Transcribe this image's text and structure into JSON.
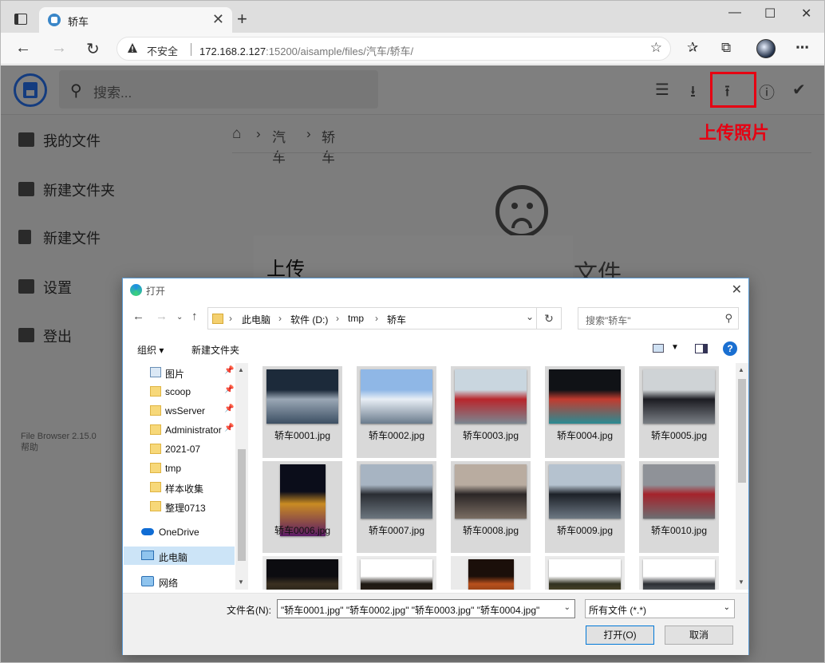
{
  "browser": {
    "tab_title": "轿车",
    "insecure_label": "不安全",
    "url_host": "172.168.2.127",
    "url_port": ":15200",
    "url_path": "/aisample/files/汽车/轿车/",
    "new_tab": "+",
    "close_tab": "✕"
  },
  "filebrowser": {
    "search_placeholder": "搜索...",
    "upload_callout": "上传照片",
    "sidebar": [
      {
        "label": "我的文件",
        "icon": "folder-icon"
      },
      {
        "label": "新建文件夹",
        "icon": "new-folder-icon"
      },
      {
        "label": "新建文件",
        "icon": "new-file-icon"
      },
      {
        "label": "设置",
        "icon": "settings-icon"
      },
      {
        "label": "登出",
        "icon": "logout-icon"
      }
    ],
    "version": "File Browser 2.15.0",
    "help": "帮助",
    "breadcrumbs": [
      "汽车",
      "轿车"
    ],
    "empty_text": "文件...",
    "modal_title": "上传"
  },
  "dialog": {
    "title": "打开",
    "path": [
      "此电脑",
      "软件 (D:)",
      "tmp",
      "轿车"
    ],
    "search_placeholder": "搜索\"轿车\"",
    "organize": "组织 ▾",
    "new_folder": "新建文件夹",
    "help": "?",
    "tree": [
      {
        "label": "图片",
        "pinned": true
      },
      {
        "label": "scoop",
        "pinned": true
      },
      {
        "label": "wsServer",
        "pinned": true
      },
      {
        "label": "Administrator",
        "pinned": true
      },
      {
        "label": "2021-07",
        "pinned": false
      },
      {
        "label": "tmp",
        "pinned": false
      },
      {
        "label": "样本收集",
        "pinned": false
      },
      {
        "label": "整理0713",
        "pinned": false
      }
    ],
    "onedrive": "OneDrive",
    "this_pc": "此电脑",
    "network": "网络",
    "files": [
      {
        "name": "轿车0001.jpg",
        "colors": [
          "#1c2a3a",
          "#9aa7b5",
          "#3c4f63"
        ]
      },
      {
        "name": "轿车0002.jpg",
        "colors": [
          "#8fb7e6",
          "#e8eef5",
          "#6a7b8c"
        ]
      },
      {
        "name": "轿车0003.jpg",
        "colors": [
          "#c9d6df",
          "#b8262c",
          "#7b8791"
        ]
      },
      {
        "name": "轿车0004.jpg",
        "colors": [
          "#101216",
          "#c23b2f",
          "#2a8b93"
        ]
      },
      {
        "name": "轿车0005.jpg",
        "colors": [
          "#cfd3d6",
          "#1c1c22",
          "#7a7f85"
        ]
      },
      {
        "name": "轿车0006.jpg",
        "colors": [
          "#0b0d1a",
          "#c98b22",
          "#5a1a66"
        ]
      },
      {
        "name": "轿车0007.jpg",
        "colors": [
          "#a7b4c2",
          "#2a2d33",
          "#6c767f"
        ]
      },
      {
        "name": "轿车0008.jpg",
        "colors": [
          "#b9aca0",
          "#2b2626",
          "#7a6d63"
        ]
      },
      {
        "name": "轿车0009.jpg",
        "colors": [
          "#b5c2cf",
          "#1d2128",
          "#6d7883"
        ]
      },
      {
        "name": "轿车0010.jpg",
        "colors": [
          "#8f9298",
          "#a5232b",
          "#6c6e72"
        ]
      },
      {
        "name": "",
        "colors": [
          "#0c0c10",
          "#3a3020",
          "#111"
        ]
      },
      {
        "name": "",
        "colors": [
          "#ffffff",
          "#1d1812",
          "#3b2f22"
        ]
      },
      {
        "name": "",
        "colors": [
          "#1b0f0a",
          "#b8501c",
          "#5b2a10"
        ]
      },
      {
        "name": "",
        "colors": [
          "#ffffff",
          "#30301f",
          "#7a6a3a"
        ]
      },
      {
        "name": "",
        "colors": [
          "#ffffff",
          "#2b2e33",
          "#9aa0a6"
        ]
      }
    ],
    "filename_label": "文件名(N):",
    "filename_value": "\"轿车0001.jpg\" \"轿车0002.jpg\" \"轿车0003.jpg\" \"轿车0004.jpg\"",
    "filter": "所有文件 (*.*)",
    "open_button": "打开(O)",
    "cancel_button": "取消"
  },
  "colors": {
    "accent": "#2979ff",
    "callout": "#e60012",
    "dialog_border": "#5b9bd5",
    "selection": "#cce4f7"
  }
}
